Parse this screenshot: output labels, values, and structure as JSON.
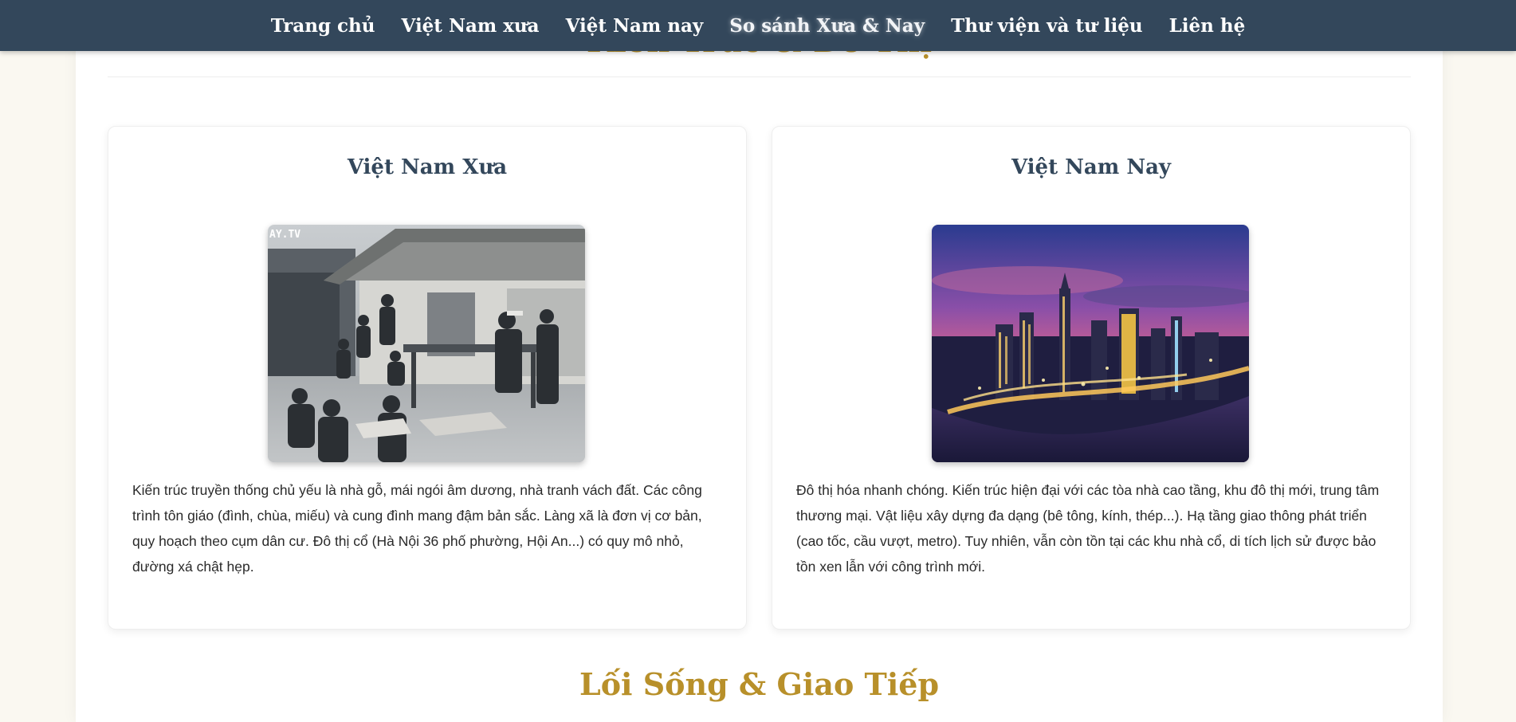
{
  "nav": {
    "items": [
      "Trang chủ",
      "Việt Nam xưa",
      "Việt Nam nay",
      "So sánh Xưa & Nay",
      "Thư viện và tư liệu",
      "Liên hệ"
    ],
    "active_index": 3
  },
  "section": {
    "title": "Kiến Trúc & Đô Thị"
  },
  "cards": {
    "past": {
      "title": "Việt Nam Xưa",
      "image_watermark": "AY.TV",
      "text": "Kiến trúc truyền thống chủ yếu là nhà gỗ, mái ngói âm dương, nhà tranh vách đất. Các công trình tôn giáo (đình, chùa, miếu) và cung đình mang đậm bản sắc. Làng xã là đơn vị cơ bản, quy hoạch theo cụm dân cư. Đô thị cổ (Hà Nội 36 phố phường, Hội An...) có quy mô nhỏ, đường xá chật hẹp."
    },
    "present": {
      "title": "Việt Nam Nay",
      "text": "Đô thị hóa nhanh chóng. Kiến trúc hiện đại với các tòa nhà cao tầng, khu đô thị mới, trung tâm thương mại. Vật liệu xây dựng đa dạng (bê tông, kính, thép...). Hạ tầng giao thông phát triển (cao tốc, cầu vượt, metro). Tuy nhiên, vẫn còn tồn tại các khu nhà cổ, di tích lịch sử được bảo tồn xen lẫn với công trình mới."
    }
  },
  "next_section": {
    "title": "Lối Sống & Giao Tiếp"
  },
  "colors": {
    "nav_bg": "#33475b",
    "heading_gold": "#b8902a",
    "card_title": "#33475b",
    "page_bg": "#faf8f1"
  }
}
